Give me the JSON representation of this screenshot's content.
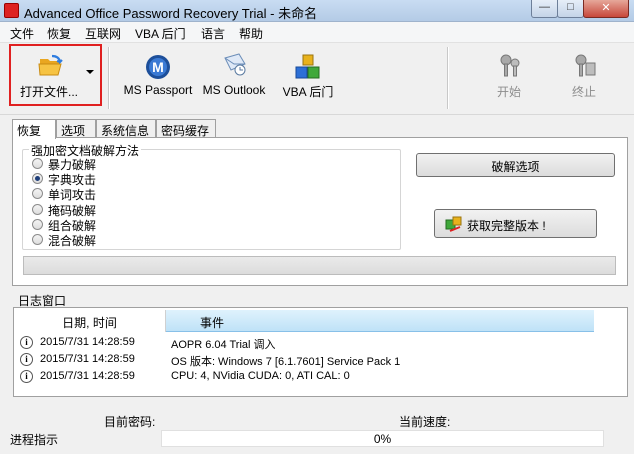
{
  "window": {
    "title": "Advanced Office Password Recovery Trial - 未命名",
    "min_glyph": "—",
    "max_glyph": "□",
    "close_glyph": "✕"
  },
  "menu": [
    "文件",
    "恢复",
    "互联网",
    "VBA 后门",
    "语言",
    "帮助"
  ],
  "toolbar": {
    "open_label": "打开文件...",
    "ms_passport_label": "MS Passport",
    "ms_outlook_label": "MS Outlook",
    "vba_label": "VBA 后门",
    "start_label": "开始",
    "stop_label": "终止"
  },
  "tabs": [
    "恢复",
    "选项",
    "系统信息",
    "密码缓存"
  ],
  "recovery": {
    "group_title": "强加密文档破解方法",
    "methods": [
      "暴力破解",
      "字典攻击",
      "单词攻击",
      "掩码破解",
      "组合破解",
      "混合破解"
    ],
    "selected_index": 1,
    "crack_options_label": "破解选项",
    "get_full_label": "获取完整版本 !"
  },
  "log": {
    "title": "日志窗口",
    "col_date": "日期, 时间",
    "col_event": "事件",
    "rows": [
      {
        "date": "2015/7/31 14:28:59",
        "event": "AOPR 6.04 Trial 调入"
      },
      {
        "date": "2015/7/31 14:28:59",
        "event": "OS 版本: Windows 7 [6.1.7601] Service Pack 1"
      },
      {
        "date": "2015/7/31 14:28:59",
        "event": "CPU: 4, NVidia CUDA: 0, ATI CAL: 0"
      }
    ]
  },
  "status": {
    "current_password_label": "目前密码:",
    "current_speed_label": "当前速度:",
    "progress_label": "进程指示",
    "progress_value": "0%"
  },
  "colors": {
    "highlight_border": "#e02020",
    "log_header_accent": "#bfe2f7"
  },
  "icons": {
    "open": "folder-open-icon",
    "ms_passport": "ms-passport-icon",
    "ms_outlook": "ms-outlook-icon",
    "vba": "vba-cubes-icon",
    "start": "start-keys-icon",
    "stop": "stop-keys-icon",
    "info": "info-icon"
  }
}
